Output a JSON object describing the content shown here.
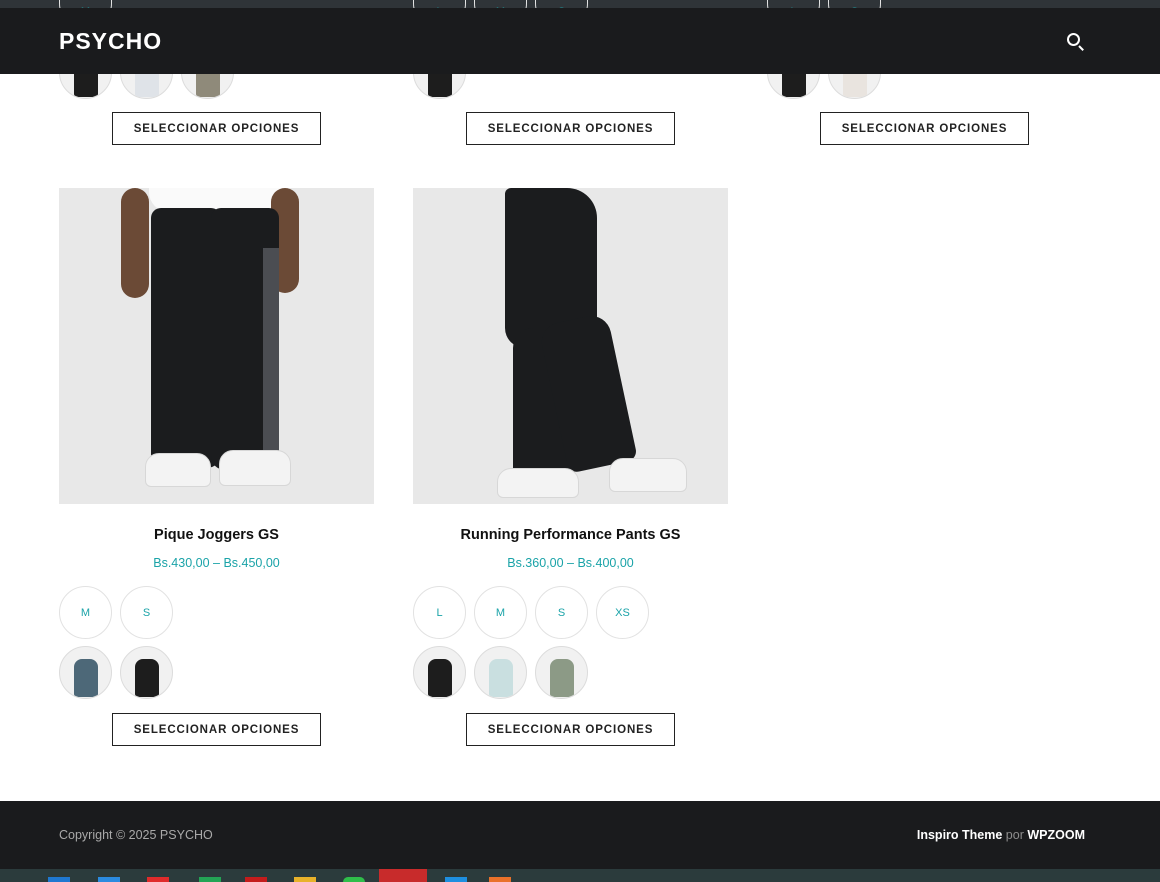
{
  "header": {
    "logo": "PSYCHO"
  },
  "top_row": [
    {
      "sizes": [
        "M"
      ],
      "swatch_colors": [
        "#1d1d1d",
        "#dfe3e8",
        "#8f8a7a"
      ],
      "button": "SELECCIONAR OPCIONES"
    },
    {
      "sizes": [
        "L",
        "M",
        "S"
      ],
      "swatch_colors": [
        "#1d1d1d"
      ],
      "button": "SELECCIONAR OPCIONES"
    },
    {
      "sizes": [
        "L",
        "S"
      ],
      "swatch_colors": [
        "#1d1d1d",
        "#e9e4df"
      ],
      "button": "SELECCIONAR OPCIONES"
    }
  ],
  "products": [
    {
      "title": "Pique Joggers GS",
      "price": "Bs.430,00 – Bs.450,00",
      "sizes": [
        "M",
        "S"
      ],
      "swatch_colors": [
        "#4d6878",
        "#1d1d1d"
      ],
      "button": "SELECCIONAR OPCIONES"
    },
    {
      "title": "Running Performance Pants GS",
      "price": "Bs.360,00 – Bs.400,00",
      "sizes": [
        "L",
        "M",
        "S",
        "XS"
      ],
      "swatch_colors": [
        "#1d1d1d",
        "#c9dfe0",
        "#8c9a86"
      ],
      "button": "SELECCIONAR OPCIONES"
    }
  ],
  "footer": {
    "copyright": "Copyright © 2025 PSYCHO",
    "theme": "Inspiro Theme",
    "por": "por",
    "author": "WPZOOM"
  },
  "colors": {
    "accent": "#1aa3a8",
    "header_bg": "#1a1b1d"
  }
}
